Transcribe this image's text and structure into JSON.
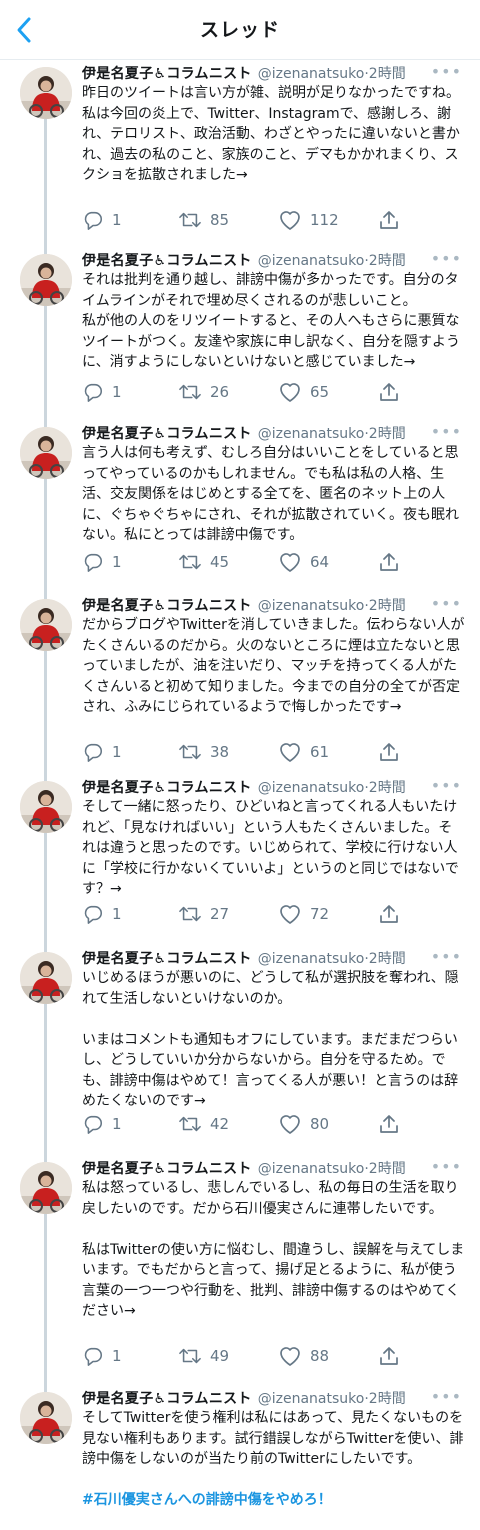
{
  "header": {
    "title": "スレッド",
    "back_icon": "chevron-left-icon"
  },
  "colors": {
    "accent": "#1da1f2",
    "muted": "#657786",
    "line": "#ccd6dd",
    "hashtag": "#1b95e0"
  },
  "tweets": [
    {
      "name": "伊是名夏子♿コラムニスト",
      "handle": "@izenanatsuko",
      "sep": "·",
      "time": "2時間",
      "text": "昨日のツイートは言い方が雑、説明が足りなかったですね。\n私は今回の炎上で、Twitter、Instagramで、感謝しろ、謝れ、テロリスト、政治活動、わざとやったに違いないと書かれ、過去の私のこと、家族のこと、デマもかかれまくり、スクショを拡散されました→",
      "replies": "1",
      "retweets": "85",
      "likes": "112"
    },
    {
      "name": "伊是名夏子♿コラムニスト",
      "handle": "@izenanatsuko",
      "sep": "·",
      "time": "2時間",
      "text": "それは批判を通り越し、誹謗中傷が多かったです。自分のタイムラインがそれで埋め尽くされるのが悲しいこと。\n私が他の人のをリツイートすると、その人へもさらに悪質なツイートがつく。友達や家族に申し訳なく、自分を隠すように、消すようにしないといけないと感じていました→",
      "replies": "1",
      "retweets": "26",
      "likes": "65"
    },
    {
      "name": "伊是名夏子♿コラムニスト",
      "handle": "@izenanatsuko",
      "sep": "·",
      "time": "2時間",
      "text": "言う人は何も考えず、むしろ自分はいいことをしていると思ってやっているのかもしれません。でも私は私の人格、生活、交友関係をはじめとする全てを、匿名のネット上の人に、ぐちゃぐちゃにされ、それが拡散されていく。夜も眠れない。私にとっては誹謗中傷です。",
      "replies": "1",
      "retweets": "45",
      "likes": "64"
    },
    {
      "name": "伊是名夏子♿コラムニスト",
      "handle": "@izenanatsuko",
      "sep": "·",
      "time": "2時間",
      "text": "だからブログやTwitterを消していきました。伝わらない人がたくさんいるのだから。火のないところに煙は立たないと思っていましたが、油を注いだり、マッチを持ってくる人がたくさんいると初めて知りました。今までの自分の全てが否定され、ふみにじられているようで悔しかったです→",
      "replies": "1",
      "retweets": "38",
      "likes": "61"
    },
    {
      "name": "伊是名夏子♿コラムニスト",
      "handle": "@izenanatsuko",
      "sep": "·",
      "time": "2時間",
      "text": "そして一緒に怒ったり、ひどいねと言ってくれる人もいたけれど、「見なければいい」という人もたくさんいました。それは違うと思ったのです。いじめられて、学校に行けない人に「学校に行かないくていいよ」というのと同じではないです？→",
      "replies": "1",
      "retweets": "27",
      "likes": "72"
    },
    {
      "name": "伊是名夏子♿コラムニスト",
      "handle": "@izenanatsuko",
      "sep": "·",
      "time": "2時間",
      "text": "いじめるほうが悪いのに、どうして私が選択肢を奪われ、隠れて生活しないといけないのか。\n\nいまはコメントも通知もオフにしています。まだまだつらいし、どうしていいか分からないから。自分を守るため。でも、誹謗中傷はやめて！言ってくる人が悪い！と言うのは辞めたくないのです→",
      "replies": "1",
      "retweets": "42",
      "likes": "80"
    },
    {
      "name": "伊是名夏子♿コラムニスト",
      "handle": "@izenanatsuko",
      "sep": "·",
      "time": "2時間",
      "text": "私は怒っているし、悲しんでいるし、私の毎日の生活を取り戻したいのです。だから石川優実さんに連帯したいです。\n\n私はTwitterの使い方に悩むし、間違うし、誤解を与えてしまいます。でもだからと言って、揚げ足とるように、私が使う言葉の一つ一つや行動を、批判、誹謗中傷するのはやめてください→",
      "replies": "1",
      "retweets": "49",
      "likes": "88"
    },
    {
      "name": "伊是名夏子♿コラムニスト",
      "handle": "@izenanatsuko",
      "sep": "·",
      "time": "2時間",
      "text": "そしてTwitterを使う権利は私にはあって、見たくないものを見ない権利もあります。試行錯誤しながらTwitterを使い、誹謗中傷をしないのが当たり前のTwitterにしたいです。",
      "hashtag": "#石川優実さんへの誹謗中傷をやめろ！"
    }
  ]
}
